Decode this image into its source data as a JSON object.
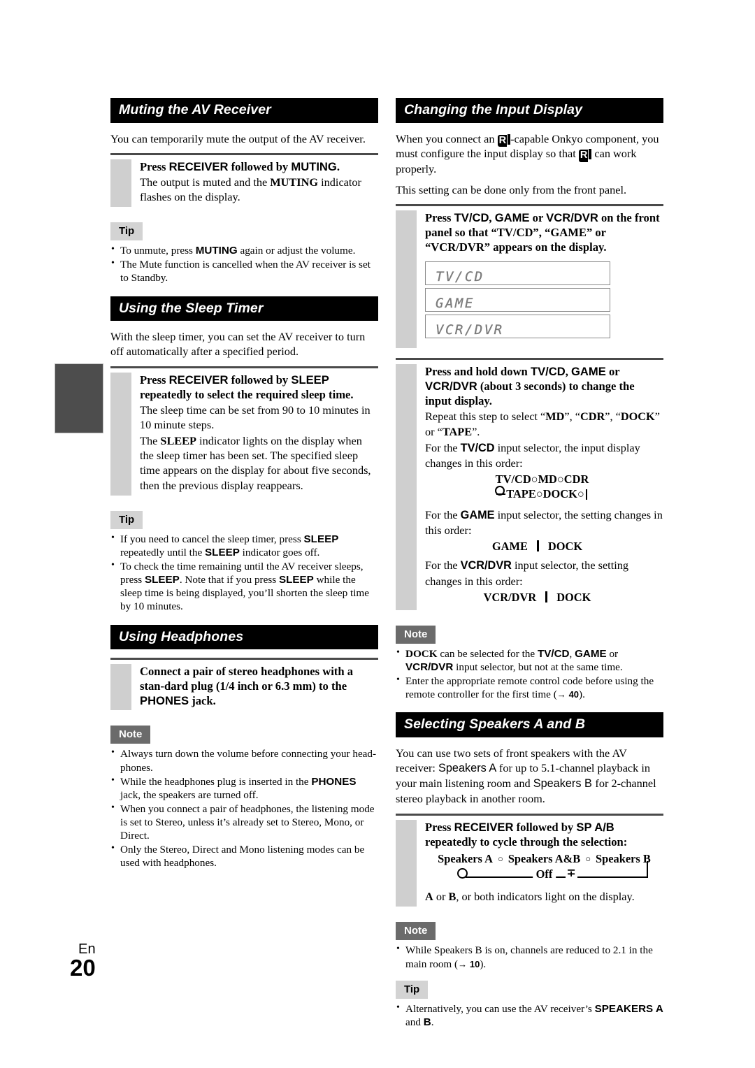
{
  "page": {
    "language_code": "En",
    "page_number": "20"
  },
  "left_column": {
    "sections": [
      {
        "id": "muting",
        "heading": "Muting the AV Receiver",
        "intro": "You can temporarily mute the output of the AV receiver.",
        "step": {
          "lead_parts": [
            "Press ",
            "RECEIVER",
            " followed by ",
            "MUTING",
            "."
          ],
          "lead_plain": "Press RECEIVER followed by MUTING.",
          "sub_plain": "The output is muted and the MUTING indicator flashes on the display.",
          "sub_bold_terms": [
            "MUTING"
          ]
        },
        "tip_badge": "Tip",
        "tips": [
          "To unmute, press MUTING again or adjust the volume.",
          "The Mute function is cancelled when the AV receiver is set to Standby."
        ]
      },
      {
        "id": "sleep-timer",
        "heading": "Using the Sleep Timer",
        "intro": "With the sleep timer, you can set the AV receiver to turn off automatically after a specified period.",
        "step": {
          "lead_plain": "Press RECEIVER followed by SLEEP repeatedly to select the required sleep time.",
          "sub1_plain": "The sleep time can be set from 90 to 10 minutes in 10 minute steps.",
          "sub2_plain": "The SLEEP indicator lights on the display when the sleep timer has been set. The specified sleep time appears on the display for about five seconds, then the previous display reappears."
        },
        "tip_badge": "Tip",
        "tips": [
          "If you need to cancel the sleep timer, press SLEEP repeatedly until the SLEEP indicator goes off.",
          "To check the time remaining until the AV receiver sleeps, press SLEEP. Note that if you press SLEEP while the sleep time is being displayed, you'll shorten the sleep time by 10 minutes."
        ]
      },
      {
        "id": "headphones",
        "heading": "Using Headphones",
        "step": {
          "lead_plain": "Connect a pair of stereo headphones with a standard plug (1/4 inch or 6.3 mm) to the PHONES jack."
        },
        "note_badge": "Note",
        "notes": [
          "Always turn down the volume before connecting your headphones.",
          "While the headphones plug is inserted in the PHONES jack, the speakers are turned off.",
          "When you connect a pair of headphones, the listening mode is set to Stereo, unless it's already set to Stereo, Mono, or Direct.",
          "Only the Stereo, Direct and Mono listening modes can be used with headphones."
        ]
      }
    ]
  },
  "right_column": {
    "sections": [
      {
        "id": "input-display",
        "heading": "Changing the Input Display",
        "intro_1_plain": "When you connect an RI-capable Onkyo component, you must configure the input display so that RI can work properly.",
        "intro_2_plain": "This setting can be done only from the front panel.",
        "step1": {
          "lead_plain": "Press TV/CD, GAME or VCR/DVR on the front panel so that “TV/CD”, “GAME” or “VCR/DVR” appears on the display."
        },
        "lcd_displays": [
          "TV/CD",
          "GAME",
          "VCR/DVR"
        ],
        "step2": {
          "lead_plain": "Press and hold down TV/CD, GAME or VCR/DVR (about 3 seconds) to change the input display.",
          "sub1_plain": "Repeat this step to select “MD”, “CDR”, “DOCK” or “TAPE”.",
          "sub2_plain": "For the TV/CD input selector, the input display changes in this order:",
          "sub3_plain": "For the GAME input selector, the setting changes in this order:",
          "sub4_plain": "For the VCR/DVR input selector, the setting changes in this order:"
        },
        "tvcd_cycle_row1": [
          "TV/CD",
          "MD",
          "CDR"
        ],
        "tvcd_cycle_row2": [
          "TAPE",
          "DOCK"
        ],
        "game_cycle": [
          "GAME",
          "DOCK"
        ],
        "vcrdvr_cycle": [
          "VCR/DVR",
          "DOCK"
        ],
        "note_badge": "Note",
        "notes": [
          "DOCK can be selected for the TV/CD, GAME or VCR/DVR input selector, but not at the same time.",
          "Enter the appropriate remote control code before using the remote controller for the first time (→ 40)."
        ],
        "note2_page_ref": "40"
      },
      {
        "id": "speakers-ab",
        "heading": "Selecting Speakers A and B",
        "intro_plain": "You can use two sets of front speakers with the AV receiver: Speakers A for up to 5.1-channel playback in your main listening room and Speakers B for 2-channel stereo playback in another room.",
        "step": {
          "lead_plain": "Press RECEIVER followed by SP A/B repeatedly to cycle through the selection:",
          "cycle_row1": [
            "Speakers A",
            "Speakers A&B",
            "Speakers B"
          ],
          "cycle_off_label": "Off",
          "sub_plain": "A or B, or both indicators light on the display."
        },
        "note_badge": "Note",
        "notes": [
          "While Speakers B is on, channels are reduced to 2.1 in the main room (→ 10)."
        ],
        "note_page_ref": "10",
        "tip_badge": "Tip",
        "tips": [
          "Alternatively, you can use the AV receiver's SPEAKERS A and B."
        ]
      }
    ]
  }
}
